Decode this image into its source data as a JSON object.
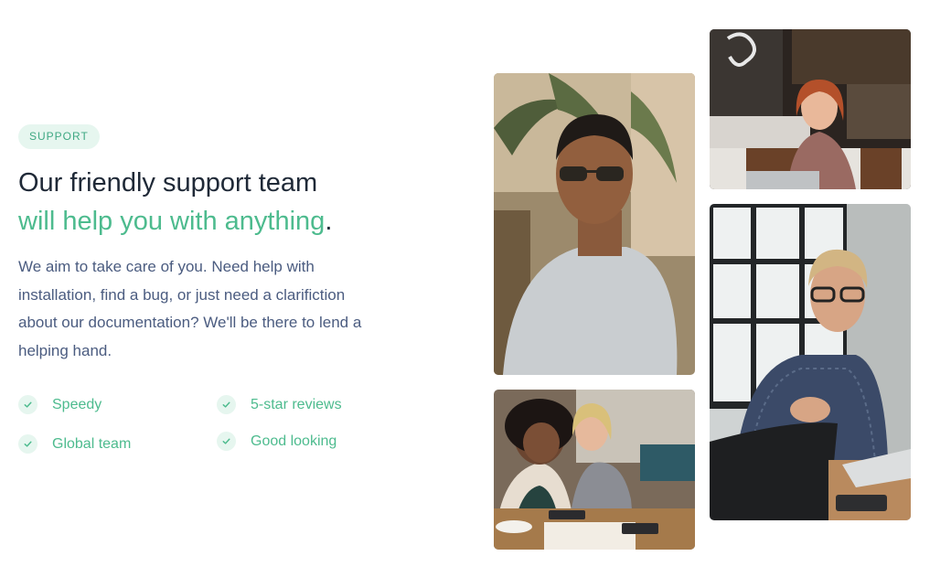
{
  "badge": "SUPPORT",
  "heading": {
    "line1": "Our friendly support team",
    "line2_accent": "will help you with anything",
    "line2_end": "."
  },
  "description": "We aim to take care of you. Need help with installation, find a bug, or just need a clarifiction about our documentation? We'll be there to lend a helping hand.",
  "features": [
    {
      "label": "Speedy"
    },
    {
      "label": "5-star reviews"
    },
    {
      "label": "Global team"
    },
    {
      "label": "Good looking"
    }
  ],
  "colors": {
    "accent": "#4dbb8e",
    "badge_bg": "#e6f6ef",
    "heading": "#1f2937",
    "body_text": "#4b5c80"
  },
  "icons": {
    "feature_icon": "check-icon"
  }
}
